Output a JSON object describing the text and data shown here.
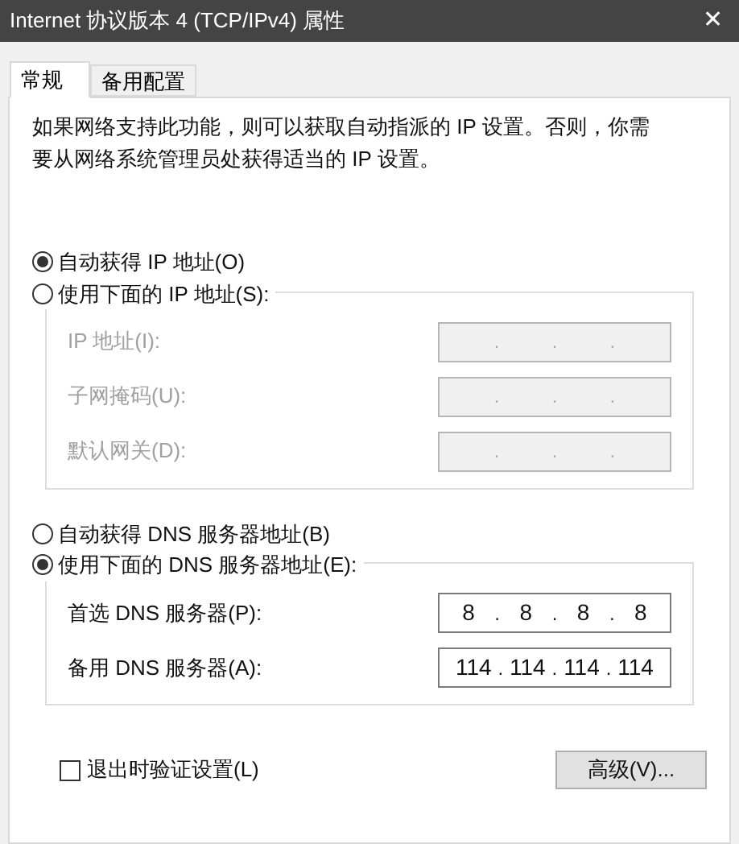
{
  "window": {
    "title": "Internet 协议版本 4 (TCP/IPv4) 属性",
    "close": "✕"
  },
  "tabs": [
    {
      "label": "常规",
      "selected": true
    },
    {
      "label": "备用配置",
      "selected": false
    }
  ],
  "description": "如果网络支持此功能，则可以获取自动指派的 IP 设置。否则，你需要从网络系统管理员处获得适当的 IP 设置。",
  "separator": ".",
  "ip_section": {
    "options": [
      {
        "label": "自动获得 IP 地址(O)",
        "selected": true
      },
      {
        "label": "使用下面的 IP 地址(S):",
        "selected": false
      }
    ],
    "fields": [
      {
        "label": "IP 地址(I):",
        "disabled": true
      },
      {
        "label": "子网掩码(U):",
        "disabled": true
      },
      {
        "label": "默认网关(D):",
        "disabled": true
      }
    ]
  },
  "dns_section": {
    "options": [
      {
        "label": "自动获得 DNS 服务器地址(B)",
        "selected": false
      },
      {
        "label": "使用下面的 DNS 服务器地址(E):",
        "selected": true
      }
    ],
    "fields": [
      {
        "label": "首选 DNS 服务器(P):",
        "disabled": false,
        "octets": [
          "8",
          "8",
          "8",
          "8"
        ]
      },
      {
        "label": "备用 DNS 服务器(A):",
        "disabled": false,
        "octets": [
          "114",
          "114",
          "114",
          "114"
        ]
      }
    ]
  },
  "validate_on_exit": {
    "label": "退出时验证设置(L)",
    "checked": false
  },
  "advanced_button": "高级(V)..."
}
